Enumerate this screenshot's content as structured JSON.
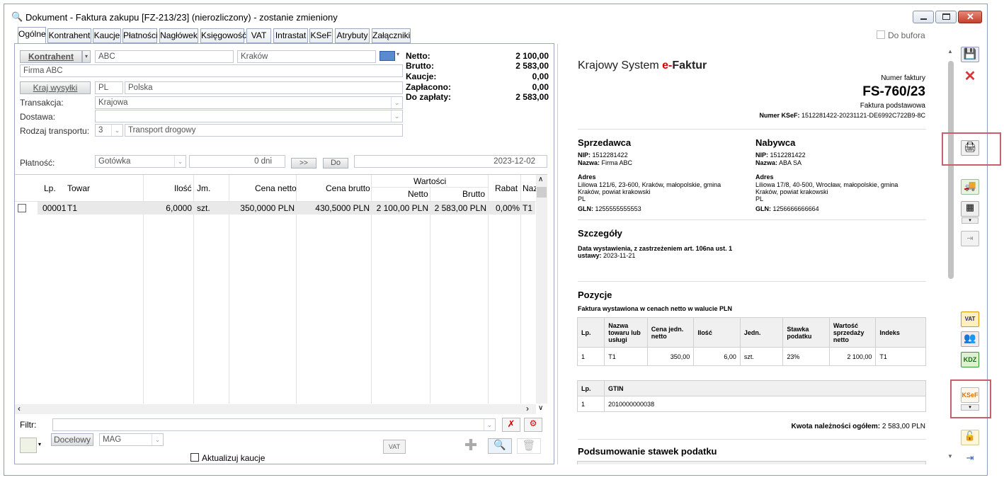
{
  "window": {
    "title": "Dokument - Faktura zakupu [FZ-213/23] (nierozliczony) - zostanie zmieniony"
  },
  "tabs": [
    "Ogólne",
    "Kontrahent",
    "Kaucje",
    "Płatności",
    "Nagłówek",
    "Księgowość",
    "VAT",
    "Intrastat",
    "KSeF",
    "Atrybuty",
    "Załączniki"
  ],
  "do_bufora": "Do bufora",
  "form": {
    "kontrahent_btn": "Kontrahent",
    "kontrahent_code": "ABC",
    "kontrahent_city": "Kraków",
    "kontrahent_name": "Firma ABC",
    "kraj_btn": "Kraj wysyłki",
    "kraj_code": "PL",
    "kraj_name": "Polska",
    "transakcja_lbl": "Transakcja:",
    "transakcja_val": "Krajowa",
    "dostawa_lbl": "Dostawa:",
    "dostawa_val": "",
    "rodzaj_lbl": "Rodzaj transportu:",
    "rodzaj_code": "3",
    "rodzaj_val": "Transport drogowy",
    "platnosc_lbl": "Płatność:",
    "platnosc_val": "Gotówka",
    "dni_val": "0 dni",
    "btn_next": ">>",
    "btn_do": "Do",
    "date_val": "2023-12-02"
  },
  "summary": {
    "netto_lbl": "Netto:",
    "netto": "2 100,00",
    "brutto_lbl": "Brutto:",
    "brutto": "2 583,00",
    "kaucje_lbl": "Kaucje:",
    "kaucje": "0,00",
    "zaplacono_lbl": "Zapłacono:",
    "zaplacono": "0,00",
    "dozaplaty_lbl": "Do zapłaty:",
    "dozaplaty": "2 583,00"
  },
  "grid": {
    "headers": {
      "lp": "Lp.",
      "towar": "Towar",
      "ilosc": "Ilość",
      "jm": "Jm.",
      "cena_netto": "Cena netto",
      "cena_brutto": "Cena brutto",
      "wartosci": "Wartości",
      "netto": "Netto",
      "brutto": "Brutto",
      "rabat": "Rabat",
      "naz": "Naz"
    },
    "row": {
      "lp": "00001",
      "towar": "T1",
      "ilosc": "6,0000",
      "jm": "szt.",
      "cena_netto": "350,0000 PLN",
      "cena_brutto": "430,5000 PLN",
      "netto": "2 100,00 PLN",
      "brutto": "2 583,00 PLN",
      "rabat": "0,00%",
      "naz": "T1"
    }
  },
  "filter_lbl": "Filtr:",
  "docelowy_btn": "Docelowy",
  "mag_val": "MAG",
  "aktualizuj": "Aktualizuj kaucje",
  "vat_btn": "VAT",
  "preview": {
    "brand_a": "Krajowy System ",
    "brand_e": "e-",
    "brand_b": "Faktur",
    "numer_lbl": "Numer faktury",
    "numer": "FS-760/23",
    "rodzaj": "Faktura podstawowa",
    "ksef_lbl": "Numer KSeF:",
    "ksef": "1512281422-20231121-DE6992C722B9-8C",
    "sprzedawca": {
      "title": "Sprzedawca",
      "nip_lbl": "NIP:",
      "nip": "1512281422",
      "nazwa_lbl": "Nazwa:",
      "nazwa": "Firma ABC",
      "adres_lbl": "Adres",
      "adres1": "Liliowa 121/6, 23-600, Kraków, małopolskie, gmina",
      "adres2": "Kraków, powiat krakowski",
      "kraj": "PL",
      "gln_lbl": "GLN:",
      "gln": "1255555555553"
    },
    "nabywca": {
      "title": "Nabywca",
      "nip_lbl": "NIP:",
      "nip": "1512281422",
      "nazwa_lbl": "Nazwa:",
      "nazwa": "ABA SA",
      "adres_lbl": "Adres",
      "adres1": "Liliowa 17/8, 40-500, Wrocław, małopolskie, gmina",
      "adres2": "Kraków, powiat krakowski",
      "kraj": "PL",
      "gln_lbl": "GLN:",
      "gln": "1256666666664"
    },
    "szczegoly": "Szczegóły",
    "data_lbl1": "Data wystawienia, z zastrzeżeniem art. 106na ust. 1",
    "data_lbl2": "ustawy:",
    "data_val": "2023-11-21",
    "pozycje": "Pozycje",
    "pozycje_sub": "Faktura wystawiona w cenach netto w walucie PLN",
    "tbl_h": [
      "Lp.",
      "Nazwa towaru lub usługi",
      "Cena jedn. netto",
      "Ilość",
      "Jedn.",
      "Stawka podatku",
      "Wartość sprzedaży netto",
      "Indeks"
    ],
    "tbl_r": [
      "1",
      "T1",
      "350,00",
      "6,00",
      "szt.",
      "23%",
      "2 100,00",
      "T1"
    ],
    "gtin_h": [
      "Lp.",
      "GTIN"
    ],
    "gtin_r": [
      "1",
      "2010000000038"
    ],
    "kwota_lbl": "Kwota należności ogółem:",
    "kwota": "2 583,00 PLN",
    "podsumowanie": "Podsumowanie stawek podatku"
  }
}
